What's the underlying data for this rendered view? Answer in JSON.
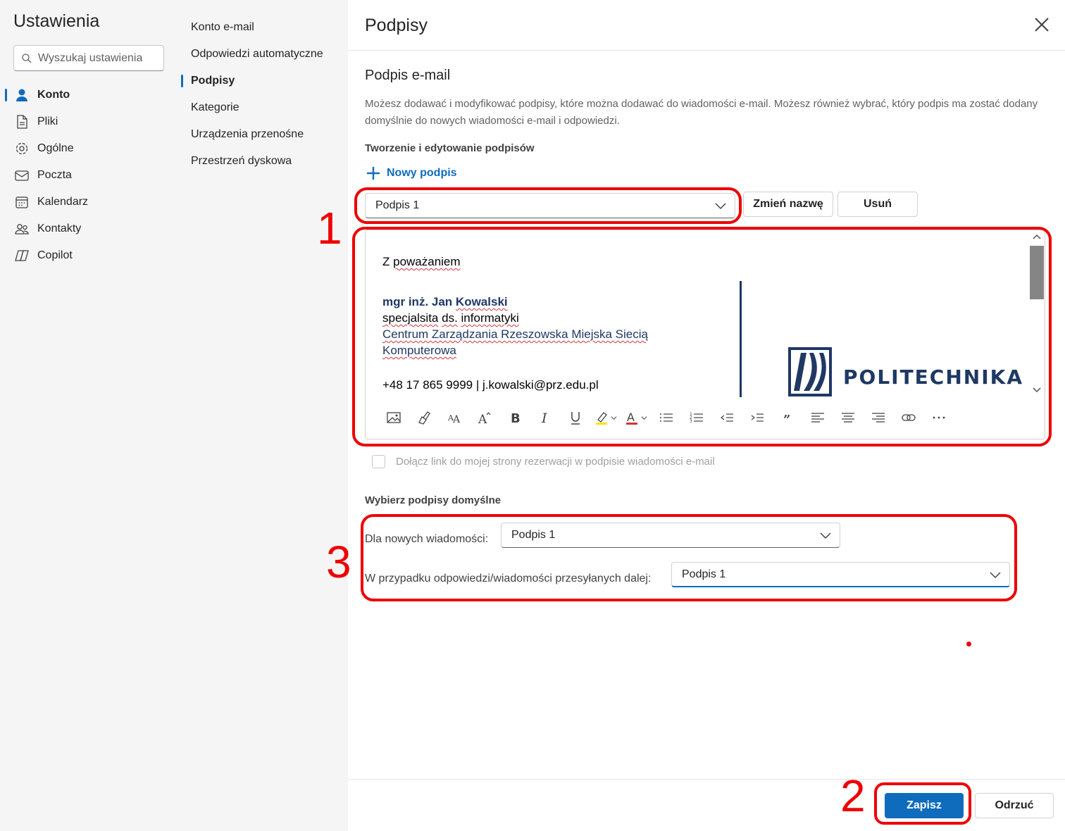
{
  "sidebar": {
    "title": "Ustawienia",
    "search_placeholder": "Wyszukaj ustawienia",
    "items": [
      {
        "label": "Konto",
        "icon": "person-icon",
        "active": true
      },
      {
        "label": "Pliki",
        "icon": "file-icon"
      },
      {
        "label": "Ogólne",
        "icon": "gear-icon"
      },
      {
        "label": "Poczta",
        "icon": "mail-icon"
      },
      {
        "label": "Kalendarz",
        "icon": "calendar-icon"
      },
      {
        "label": "Kontakty",
        "icon": "people-icon"
      },
      {
        "label": "Copilot",
        "icon": "copilot-icon"
      }
    ]
  },
  "subnav": {
    "items": [
      {
        "label": "Konto e-mail"
      },
      {
        "label": "Odpowiedzi automatyczne"
      },
      {
        "label": "Podpisy",
        "active": true
      },
      {
        "label": "Kategorie"
      },
      {
        "label": "Urządzenia przenośne"
      },
      {
        "label": "Przestrzeń dyskowa"
      }
    ]
  },
  "panel": {
    "title": "Podpisy",
    "section_title": "Podpis e-mail",
    "description": "Możesz dodawać i modyfikować podpisy, które można dodawać do wiadomości e-mail. Możesz również wybrać, który podpis ma zostać dodany domyślnie do nowych wiadomości e-mail i odpowiedzi.",
    "create_label": "Tworzenie i edytowanie podpisów",
    "new_signature": "Nowy podpis",
    "selected_signature": "Podpis 1",
    "rename_button": "Zmień nazwę",
    "delete_button": "Usuń",
    "signature": {
      "greeting_prefix": "Z ",
      "greeting_word": "poważaniem",
      "name_prefix": "mgr inż. Jan ",
      "name_last": "Kowalski",
      "role_w1": "specjalsita",
      "role_w2": "ds.",
      "role_w3": "informatyki",
      "org_line1": "Centrum Zarządzania Rzeszowska Miejska Siecią",
      "org_line2": "Komputerowa",
      "contact": "+48 17 865 9999 | j.kowalski@prz.edu.pl",
      "logo_text": "POLITECHNIKA"
    },
    "booking_checkbox_label": "Dołącz link do mojej strony rezerwacji w podpisie wiadomości e-mail",
    "defaults_title": "Wybierz podpisy domyślne",
    "new_messages_label": "Dla nowych wiadomości:",
    "new_messages_value": "Podpis 1",
    "replies_label": "W przypadku odpowiedzi/wiadomości przesyłanych dalej:",
    "replies_value": "Podpis 1",
    "save_button": "Zapisz",
    "discard_button": "Odrzuć"
  },
  "annotations": {
    "n1": "1",
    "n2": "2",
    "n3": "3",
    "color": "#e00000"
  },
  "colors": {
    "accent": "#0f6cbd",
    "signature_blue": "#1f3864"
  }
}
